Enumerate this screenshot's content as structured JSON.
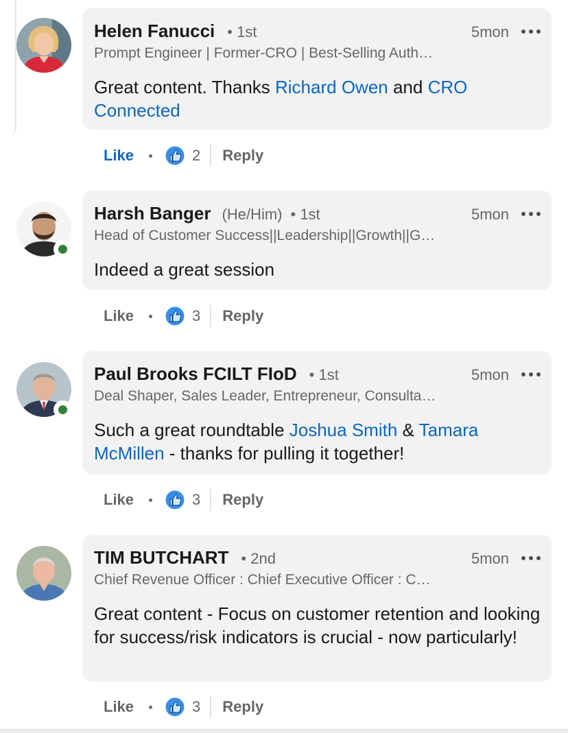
{
  "comments": [
    {
      "name": "Helen Fanucci",
      "pronouns": "",
      "degree": "• 1st",
      "time": "5mon",
      "headline": "Prompt Engineer | Former-CRO | Best-Selling Auth…",
      "text": {
        "t1": "Great content. Thanks ",
        "m1": "Richard Owen",
        "t2": " and ",
        "m2": "CRO Connected",
        "t3": ""
      },
      "like_label": "Like",
      "reaction_icon": "like-reaction-icon",
      "reaction_count": "2",
      "reply_label": "Reply",
      "liked": true,
      "online": false
    },
    {
      "name": "Harsh Banger",
      "pronouns": "(He/Him)",
      "degree": "• 1st",
      "time": "5mon",
      "headline": "Head of Customer Success||Leadership||Growth||G…",
      "text": {
        "t1": "Indeed a great session",
        "m1": "",
        "t2": "",
        "m2": "",
        "t3": ""
      },
      "like_label": "Like",
      "reaction_icon": "like-reaction-icon",
      "reaction_count": "3",
      "reply_label": "Reply",
      "liked": false,
      "online": true
    },
    {
      "name": "Paul Brooks FCILT FIoD",
      "pronouns": "",
      "degree": "• 1st",
      "time": "5mon",
      "headline": "Deal Shaper, Sales Leader, Entrepreneur, Consulta…",
      "text": {
        "t1": "Such a great roundtable ",
        "m1": "Joshua Smith",
        "t2": " & ",
        "m2": "Tamara McMillen",
        "t3": " - thanks for pulling it together!"
      },
      "like_label": "Like",
      "reaction_icon": "like-reaction-icon",
      "reaction_count": "3",
      "reply_label": "Reply",
      "liked": false,
      "online": true
    },
    {
      "name": "TIM BUTCHART",
      "pronouns": "",
      "degree": "• 2nd",
      "time": "5mon",
      "headline": "Chief Revenue Officer : Chief Executive Officer : C…",
      "text": {
        "t1": "Great content - Focus on customer retention and looking for success/risk indicators is crucial - now particularly!",
        "m1": "",
        "t2": "",
        "m2": "",
        "t3": ""
      },
      "like_label": "Like",
      "reaction_icon": "like-reaction-icon",
      "reaction_count": "3",
      "reply_label": "Reply",
      "liked": false,
      "online": false
    }
  ],
  "colors": {
    "bubble": "#f2f2f2",
    "link": "#0a66c2",
    "muted": "#666666",
    "online": "#338037"
  }
}
